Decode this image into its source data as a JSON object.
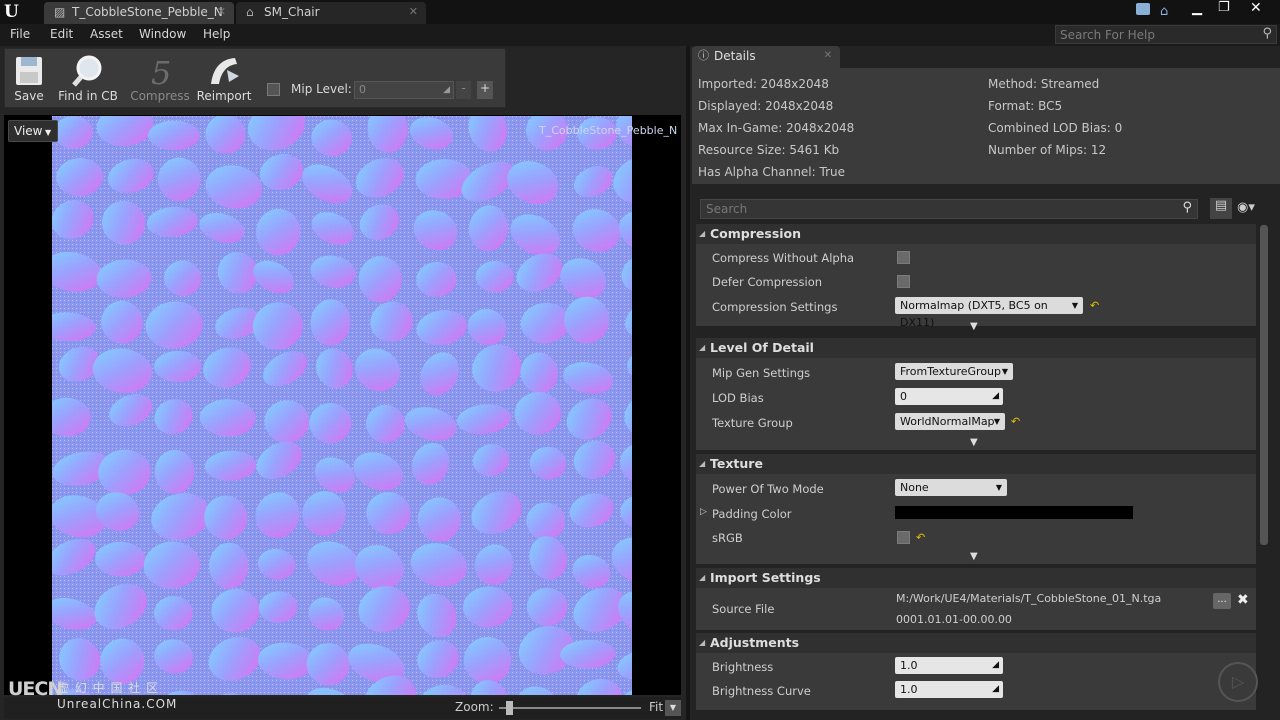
{
  "app": {
    "logo": "unreal-logo-icon"
  },
  "tabs": [
    {
      "label": "T_CobbleStone_Pebble_N",
      "icon": "texture-icon"
    },
    {
      "label": "SM_Chair",
      "icon": "mesh-icon"
    }
  ],
  "menu": [
    "File",
    "Edit",
    "Asset",
    "Window",
    "Help"
  ],
  "search_help": {
    "placeholder": "Search For Help"
  },
  "toolbar": {
    "save": "Save",
    "find_in_cb": "Find in CB",
    "compress": "Compress",
    "reimport": "Reimport",
    "mip_label": "Mip Level:",
    "mip_value": "0",
    "minus": "-",
    "plus": "+"
  },
  "viewport": {
    "view_button": "View",
    "texture_name": "T_CobbleStone_Pebble_N",
    "zoom_label": "Zoom:",
    "zoom_mode": "Fit"
  },
  "watermark": {
    "brand": "UECN",
    "cn": "虚 幻 中 国 社 区",
    "site": "UnrealChina.COM"
  },
  "details": {
    "tab_label": "Details",
    "info": {
      "imported": "Imported: 2048x2048",
      "displayed": "Displayed: 2048x2048",
      "max_ingame": "Max In-Game: 2048x2048",
      "resource_size": "Resource Size: 5461 Kb",
      "has_alpha": "Has Alpha Channel: True",
      "method": "Method: Streamed",
      "format": "Format: BC5",
      "combined_lod": "Combined LOD Bias: 0",
      "num_mips": "Number of Mips: 12"
    },
    "search_placeholder": "Search",
    "compression": {
      "title": "Compression",
      "compress_without_alpha": "Compress Without Alpha",
      "defer_compression": "Defer Compression",
      "compression_settings": "Compression Settings",
      "compression_settings_value": "Normalmap (DXT5, BC5 on DX11)"
    },
    "lod": {
      "title": "Level Of Detail",
      "mip_gen": "Mip Gen Settings",
      "mip_gen_value": "FromTextureGroup",
      "lod_bias": "LOD Bias",
      "lod_bias_value": "0",
      "texture_group": "Texture Group",
      "texture_group_value": "WorldNormalMap"
    },
    "texture": {
      "title": "Texture",
      "power_two": "Power Of Two Mode",
      "power_two_value": "None",
      "padding_color": "Padding Color",
      "srgb": "sRGB"
    },
    "import": {
      "title": "Import Settings",
      "source_file": "Source File",
      "source_path": "M:/Work/UE4/Materials/T_CobbleStone_01_N.tga",
      "source_time": "0001.01.01-00.00.00",
      "browse": "..."
    },
    "adjust": {
      "title": "Adjustments",
      "brightness": "Brightness",
      "brightness_value": "1.0",
      "brightness_curve": "Brightness Curve",
      "brightness_curve_value": "1.0"
    }
  },
  "colors": {
    "accent": "#e5c100",
    "padding_color": "#000000"
  }
}
